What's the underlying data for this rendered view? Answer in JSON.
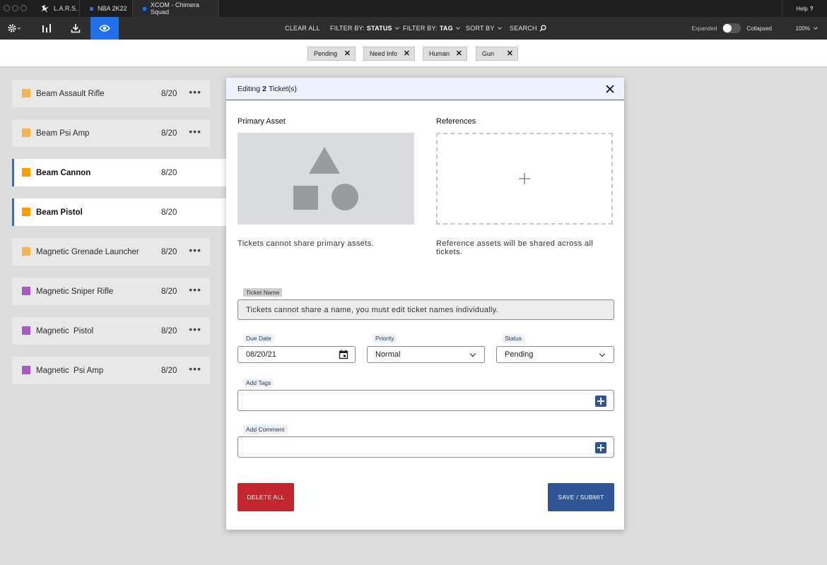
{
  "titlebar": {
    "tabs": [
      {
        "label": "L.A.R.S.",
        "icon": "lars-logo-icon"
      },
      {
        "label": "NBA 2K22",
        "color": "#2f6fd6"
      },
      {
        "label": "XCOM - Chimera Squad",
        "color": "#1f6fe8"
      }
    ],
    "help_label": "Help",
    "help_mark": "?"
  },
  "toolbar": {
    "icons": [
      "gear-icon",
      "bar-chart-icon",
      "download-icon",
      "eye-icon"
    ],
    "clear_all": "CLEAR ALL",
    "filter_status_prefix": "FILTER BY:",
    "filter_status_value": "STATUS",
    "filter_tag_prefix": "FILTER BY:",
    "filter_tag_value": "TAG",
    "sort_by": "SORT BY",
    "search": "SEARCH",
    "expanded": "Expanded",
    "collapsed": "Collapsed",
    "zoom": "100%"
  },
  "filters": [
    "Pending",
    "Need Info",
    "Human",
    "Gun"
  ],
  "colors": {
    "orange": "#f7b24a",
    "orange_selected": "#ff9a00",
    "purple": "#a558c9",
    "accent": "#1f6fe8",
    "primary": "#2f5597",
    "danger": "#c1272d"
  },
  "tickets": [
    {
      "name": "Beam Assault Rifle",
      "count": "8/20",
      "more": "•••"
    },
    {
      "name": "Beam Psi Amp",
      "count": "8/20",
      "more": "•••"
    },
    {
      "name": "Beam Cannon",
      "count": "8/20"
    },
    {
      "name": "Beam Pistol",
      "count": "8/20"
    },
    {
      "name": "Magnetic Grenade Launcher",
      "count": "8/20",
      "more": "•••"
    },
    {
      "name": "Magnetic Sniper Rifle",
      "count": "8/20",
      "more": "•••"
    },
    {
      "name": "Magnetic  Pistol",
      "count": "8/20",
      "more": "•••"
    },
    {
      "name": "Magnetic  Psi Amp",
      "count": "8/20",
      "more": "•••"
    }
  ],
  "modal": {
    "title_prefix": "Editing",
    "title_count": "2",
    "title_suffix": "Ticket(s)",
    "primary_asset_label": "Primary Asset",
    "references_label": "References",
    "primary_note": "Tickets cannot share primary assets.",
    "references_note": "Reference assets will be shared across all tickets.",
    "ticket_name_label": "Ticket Name",
    "ticket_name_value": "Tickets cannot share a name, you must edit ticket names individually.",
    "due_date_label": "Due Date",
    "due_date_value": "08/20/21",
    "priority_label": "Priority",
    "priority_value": "Normal",
    "status_label": "Status",
    "status_value": "Pending",
    "tags_label": "Add Tags",
    "comment_label": "Add Comment",
    "delete_all": "DELETE ALL",
    "save_submit": "SAVE / SUBMIT"
  }
}
